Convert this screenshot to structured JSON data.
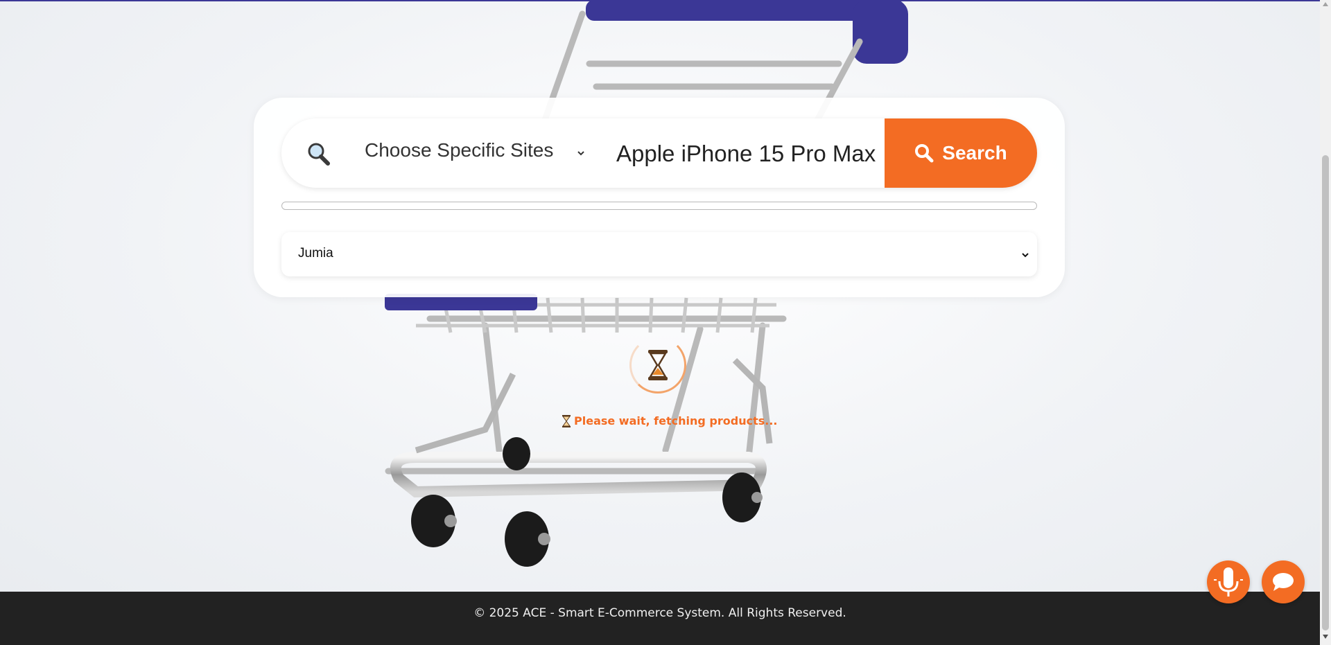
{
  "search": {
    "site_chooser_label": "Choose Specific Sites",
    "query_value": "Apple iPhone 15 Pro Max",
    "button_label": "Search",
    "icon": "search-icon"
  },
  "site_select": {
    "selected": "Jumia"
  },
  "progress": {
    "fraction": 0
  },
  "loading": {
    "message": "Please wait, fetching products..."
  },
  "footer": {
    "copyright": "© 2025 ACE - Smart E-Commerce System. All Rights Reserved."
  },
  "floating_buttons": {
    "voice": "microphone-icon",
    "chat": "chat-bubble-icon"
  },
  "colors": {
    "accent": "#f36c23",
    "footer_bg": "#222222",
    "cart_blue": "#3b3796"
  }
}
